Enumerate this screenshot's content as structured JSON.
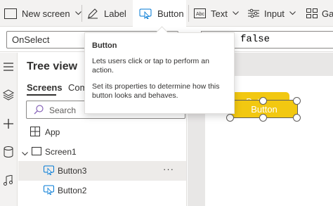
{
  "ribbon": {
    "new_screen": "New screen",
    "label": "Label",
    "button": "Button",
    "text": "Text",
    "input": "Input",
    "gallery": "Ga"
  },
  "formula_bar": {
    "property": "OnSelect",
    "formula": "false"
  },
  "tooltip": {
    "title": "Button",
    "line1": "Lets users click or tap to perform an action.",
    "line2": "Set its properties to determine how this button looks and behaves."
  },
  "tree_view": {
    "title": "Tree view",
    "tabs": [
      "Screens",
      "Com"
    ],
    "search_placeholder": "Search",
    "nodes": {
      "app": "App",
      "screen": "Screen1",
      "button3": "Button3",
      "button2": "Button2",
      "more": "···"
    }
  },
  "canvas": {
    "button_front": "Button",
    "button_back": "Button"
  },
  "colors": {
    "accent": "#0078d4",
    "button_fill": "#f2c811",
    "selected_row": "#edebe9"
  }
}
